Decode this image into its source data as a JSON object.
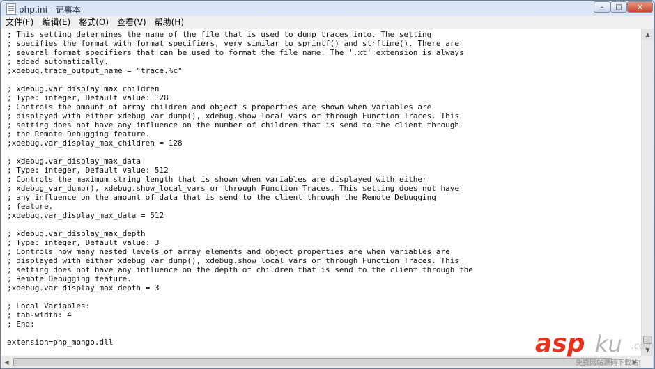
{
  "window": {
    "title": "php.ini - 记事本",
    "icon": "notepad-icon",
    "controls": {
      "minimize_glyph": "–",
      "maximize_glyph": "□",
      "close_glyph": "✕"
    }
  },
  "menu": {
    "items": [
      "文件(F)",
      "编辑(E)",
      "格式(O)",
      "查看(V)",
      "帮助(H)"
    ]
  },
  "editor": {
    "lines": [
      "; This setting determines the name of the file that is used to dump traces into. The setting",
      "; specifies the format with format specifiers, very similar to sprintf() and strftime(). There are",
      "; several format specifiers that can be used to format the file name. The '.xt' extension is always",
      "; added automatically.",
      ";xdebug.trace_output_name = \"trace.%c\"",
      "",
      "; xdebug.var_display_max_children",
      "; Type: integer, Default value: 128",
      "; Controls the amount of array children and object's properties are shown when variables are",
      "; displayed with either xdebug_var_dump(), xdebug.show_local_vars or through Function Traces. This",
      "; setting does not have any influence on the number of children that is send to the client through",
      "; the Remote Debugging feature.",
      ";xdebug.var_display_max_children = 128",
      "",
      "; xdebug.var_display_max_data",
      "; Type: integer, Default value: 512",
      "; Controls the maximum string length that is shown when variables are displayed with either",
      "; xdebug_var_dump(), xdebug.show_local_vars or through Function Traces. This setting does not have",
      "; any influence on the amount of data that is send to the client through the Remote Debugging",
      "; feature.",
      ";xdebug.var_display_max_data = 512",
      "",
      "; xdebug.var_display_max_depth",
      "; Type: integer, Default value: 3",
      "; Controls how many nested levels of array elements and object properties are when variables are",
      "; displayed with either xdebug_var_dump(), xdebug.show_local_vars or through Function Traces. This",
      "; setting does not have any influence on the depth of children that is send to the client through the",
      "; Remote Debugging feature.",
      ";xdebug.var_display_max_depth = 3",
      "",
      "; Local Variables:",
      "; tab-width: 4",
      "; End:",
      "",
      "extension=php_mongo.dll"
    ]
  },
  "watermark": {
    "brand_red": "asp",
    "brand_grey": "ku",
    "suffix": ".com",
    "tagline": "免费网站源码下载站!",
    "color_red": "#e8301c"
  },
  "scrollbars": {
    "up_glyph": "▲",
    "down_glyph": "▼",
    "left_glyph": "◀",
    "right_glyph": "▶"
  }
}
